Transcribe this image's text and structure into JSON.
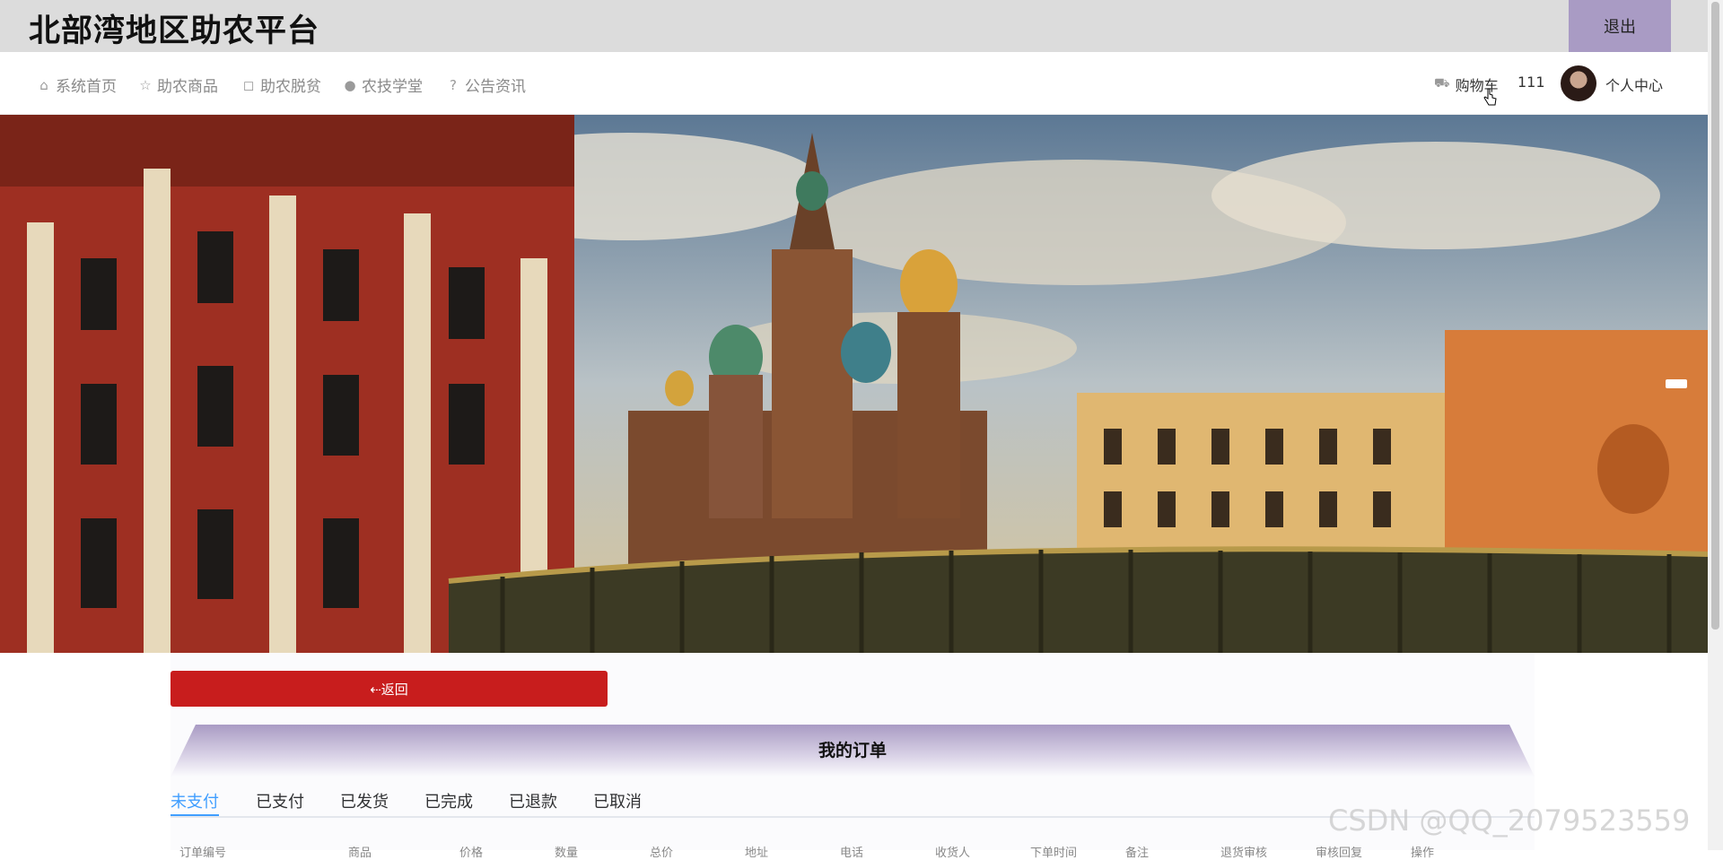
{
  "header": {
    "site_title": "北部湾地区助农平台",
    "logout_label": "退出"
  },
  "nav": {
    "items": [
      {
        "label": "系统首页",
        "icon": "home-icon",
        "glyph": "⌂"
      },
      {
        "label": "助农商品",
        "icon": "star-icon",
        "glyph": "☆"
      },
      {
        "label": "助农脱贫",
        "icon": "bag-icon",
        "glyph": "◻"
      },
      {
        "label": "农技学堂",
        "icon": "info-circle-icon",
        "glyph": "●"
      },
      {
        "label": "公告资讯",
        "icon": "question-circle-icon",
        "glyph": "?"
      }
    ],
    "cart_label": "购物车",
    "username": "111",
    "profile_label": "个人中心"
  },
  "main": {
    "back_label": "⇠返回",
    "orders_title": "我的订单",
    "tabs": [
      "未支付",
      "已支付",
      "已发货",
      "已完成",
      "已退款",
      "已取消"
    ],
    "active_tab": "未支付",
    "columns": [
      "订单编号",
      "商品",
      "价格",
      "数量",
      "总价",
      "地址",
      "电话",
      "收货人",
      "下单时间",
      "备注",
      "退货审核",
      "审核回复",
      "操作"
    ]
  },
  "watermark": "CSDN @QQ_2079523559",
  "colors": {
    "topbar": "#dcdcdc",
    "logout": "#a99bc4",
    "back_button": "#c81d1d",
    "tab_active": "#409eff"
  }
}
